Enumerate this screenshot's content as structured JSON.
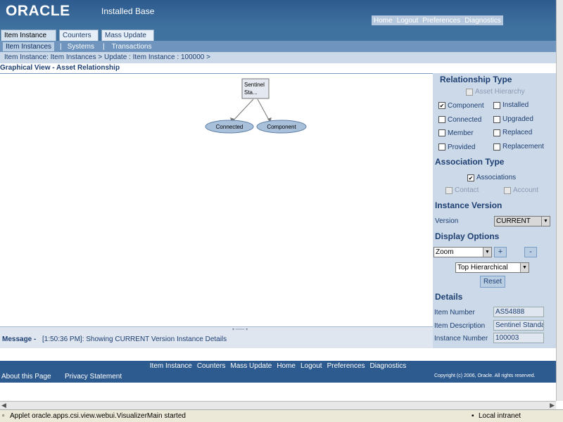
{
  "header": {
    "logo": "ORACLE",
    "app_title": "Installed Base",
    "global_links": [
      "Home",
      "Logout",
      "Preferences",
      "Diagnostics"
    ]
  },
  "tabs": [
    "Item Instance",
    "Counters",
    "Mass Update"
  ],
  "subnav": [
    "Item Instances",
    "Systems",
    "Transactions"
  ],
  "breadcrumb": "Item Instance: Item Instances  >    Update : Item Instance : 100000  >",
  "page_title": "Graphical View - Asset Relationship",
  "graph": {
    "root_label_1": "Sentinel",
    "root_label_2": "Sta...",
    "child1": "Connected",
    "child2": "Component"
  },
  "message": {
    "label": "Message -",
    "text": "[1:50:36 PM]: Showing CURRENT Version Instance Details"
  },
  "panel": {
    "relationship_type": "Relationship Type",
    "asset_hierarchy": "Asset Hierarchy",
    "component": "Component",
    "installed": "Installed",
    "connected": "Connected",
    "upgraded": "Upgraded",
    "member": "Member",
    "replaced": "Replaced",
    "provided": "Provided",
    "replacement": "Replacement",
    "association_type": "Association Type",
    "associations": "Associations",
    "contact": "Contact",
    "account": "Account",
    "instance_version": "Instance Version",
    "version_label": "Version",
    "version_value": "CURRENT",
    "display_options": "Display Options",
    "zoom_value": "Zoom",
    "plus": "+",
    "minus": "-",
    "hierarchy_value": "Top Hierarchical",
    "reset": "Reset",
    "details": "Details",
    "item_number_label": "Item Number",
    "item_number_value": "AS54888",
    "item_desc_label": "Item Description",
    "item_desc_value": "Sentinel Standa",
    "instance_number_label": "Instance Number",
    "instance_number_value": "100003"
  },
  "footer": {
    "links": [
      "Item Instance",
      "Counters",
      "Mass Update",
      "Home",
      "Logout",
      "Preferences",
      "Diagnostics"
    ],
    "about": "About this Page",
    "privacy": "Privacy Statement",
    "copyright": "Copyright (c) 2006, Oracle. All rights reserved."
  },
  "statusbar": {
    "text": "Applet oracle.apps.csi.view.webui.VisualizerMain started",
    "zone": "Local intranet"
  }
}
